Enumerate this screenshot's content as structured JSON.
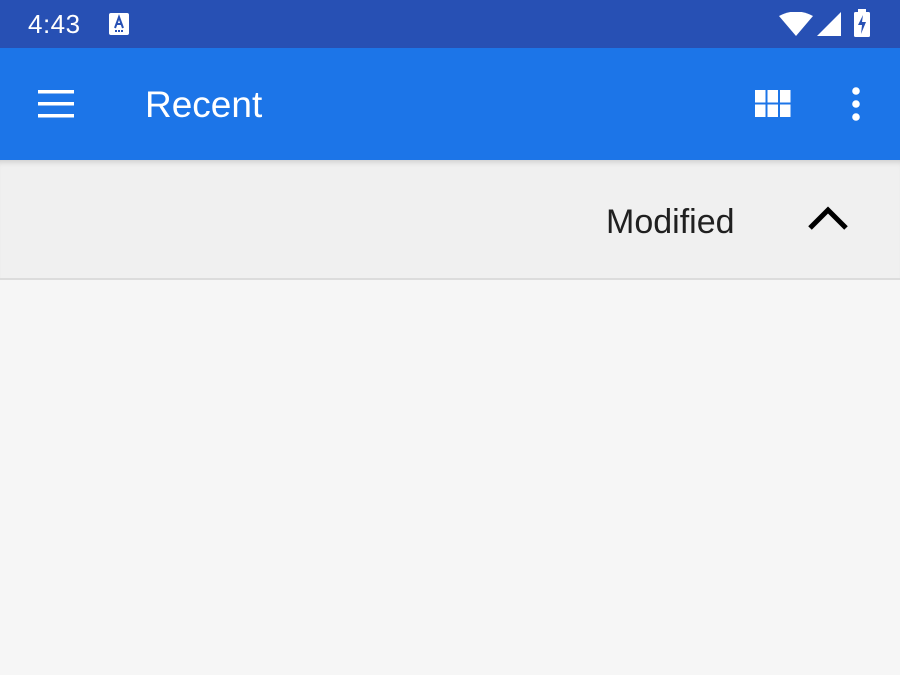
{
  "status_bar": {
    "time": "4:43",
    "icons": [
      "app-notification-icon",
      "wifi-icon",
      "cell-signal-icon",
      "battery-charging-icon"
    ],
    "background": "#2750b4"
  },
  "app_bar": {
    "title": "Recent",
    "background": "#1c75e8",
    "icons": [
      "hamburger-menu-icon",
      "grid-view-icon",
      "more-vert-icon"
    ]
  },
  "sort_bar": {
    "label": "Modified",
    "direction_icon": "chevron-up-icon"
  },
  "content": {
    "background": "#f6f6f6"
  }
}
